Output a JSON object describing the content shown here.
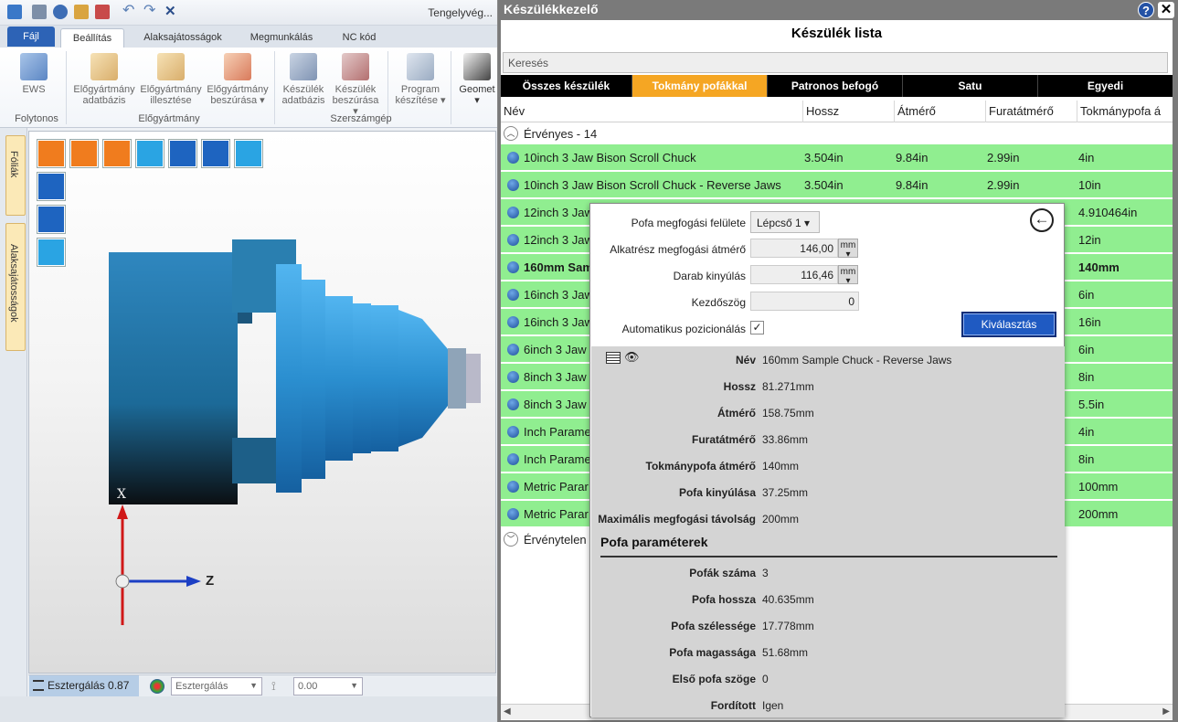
{
  "app": {
    "title": "Tengelyvég...",
    "file_tab": "Fájl",
    "tabs": [
      "Beállítás",
      "Alaksajátosságok",
      "Megmunkálás",
      "NC kód"
    ],
    "ribbon": {
      "ews": "EWS",
      "blank_db": [
        "Előgyártmány",
        "adatbázis"
      ],
      "blank_fit": [
        "Előgyártmány",
        "illesztése"
      ],
      "blank_insert": [
        "Előgyártmány",
        "beszúrása ▾"
      ],
      "dev_db": [
        "Készülék",
        "adatbázis"
      ],
      "dev_insert": [
        "Készülék",
        "beszúrása ▾"
      ],
      "prog_create": [
        "Program",
        "készítése ▾"
      ],
      "geom": [
        "Geomet",
        "▾"
      ],
      "groups": [
        "Folytonos",
        "Előgyártmány",
        "Szerszámgép"
      ]
    },
    "side_tabs": [
      "Fóliák",
      "Alaksajátosságok"
    ],
    "axes": {
      "x": "X",
      "z": "Z"
    },
    "status": {
      "mode_label": "Esztergálás 0.87",
      "op_select": "Esztergálás",
      "value_select": "0.00"
    }
  },
  "dialog": {
    "title": "Készülékkezelő",
    "help": "?",
    "close": "✕",
    "list_title": "Készülék lista",
    "search_placeholder": "Keresés",
    "categories": [
      "Összes készülék",
      "Tokmány pofákkal",
      "Patronos befogó",
      "Satu",
      "Egyedi"
    ],
    "selected_category": "Tokmány pofákkal",
    "columns": [
      "Név",
      "Hossz",
      "Átmérő",
      "Furatátmérő",
      "Tokmánypofa á"
    ],
    "valid_group": "Érvényes - 14",
    "invalid_group": "Érvénytelen",
    "rows": [
      {
        "name": "10inch 3 Jaw Bison Scroll Chuck",
        "len": "3.504in",
        "dia": "9.84in",
        "bore": "2.99in",
        "jaw": "4in"
      },
      {
        "name": "10inch 3 Jaw Bison Scroll Chuck - Reverse Jaws",
        "len": "3.504in",
        "dia": "9.84in",
        "bore": "2.99in",
        "jaw": "10in"
      },
      {
        "name": "12inch 3 Jaw",
        "len": "",
        "dia": "",
        "bore": "",
        "jaw": "4.910464in"
      },
      {
        "name": "12inch 3 Jaw",
        "len": "",
        "dia": "",
        "bore": "",
        "jaw": "12in"
      },
      {
        "name": "160mm Sam",
        "len": "",
        "dia": "",
        "bore": "",
        "jaw": "140mm"
      },
      {
        "name": "16inch 3 Jaw",
        "len": "",
        "dia": "",
        "bore": "",
        "jaw": "6in"
      },
      {
        "name": "16inch 3 Jaw",
        "len": "",
        "dia": "",
        "bore": "",
        "jaw": "16in"
      },
      {
        "name": "6inch 3 Jaw",
        "len": "",
        "dia": "",
        "bore": "",
        "jaw": "6in"
      },
      {
        "name": "8inch 3 Jaw",
        "len": "",
        "dia": "",
        "bore": "",
        "jaw": "8in"
      },
      {
        "name": "8inch 3 Jaw",
        "len": "",
        "dia": "",
        "bore": "",
        "jaw": "5.5in"
      },
      {
        "name": "Inch Parame",
        "len": "",
        "dia": "",
        "bore": "",
        "jaw": "4in"
      },
      {
        "name": "Inch Parame",
        "len": "",
        "dia": "",
        "bore": "",
        "jaw": "8in"
      },
      {
        "name": "Metric Parar",
        "len": "",
        "dia": "",
        "bore": "",
        "jaw": "100mm"
      },
      {
        "name": "Metric Parar",
        "len": "",
        "dia": "",
        "bore": "",
        "jaw": "200mm"
      }
    ]
  },
  "popup": {
    "surface_label": "Pofa megfogási felülete",
    "surface_value": "Lépcső 1 ▾",
    "part_dia_label": "Alkatrész megfogási átmérő",
    "part_dia_value": "146,00",
    "protrusion_label": "Darab kinyúlás",
    "protrusion_value": "116,46",
    "unit": "mm",
    "start_angle_label": "Kezdőszög",
    "start_angle_value": "0",
    "auto_pos_label": "Automatikus pozicionálás",
    "auto_pos_checked": "✓",
    "select_button": "Kiválasztás",
    "details": [
      {
        "label": "Név",
        "value": "160mm Sample Chuck - Reverse Jaws"
      },
      {
        "label": "Hossz",
        "value": "81.271mm"
      },
      {
        "label": "Átmérő",
        "value": "158.75mm"
      },
      {
        "label": "Furatátmérő",
        "value": "33.86mm"
      },
      {
        "label": "Tokmánypofa átmérő",
        "value": "140mm"
      },
      {
        "label": "Pofa kinyúlása",
        "value": "37.25mm"
      },
      {
        "label": "Maximális megfogási távolság",
        "value": "200mm"
      }
    ],
    "jaw_section": "Pofa paraméterek",
    "jaw_details": [
      {
        "label": "Pofák száma",
        "value": "3"
      },
      {
        "label": "Pofa hossza",
        "value": "40.635mm"
      },
      {
        "label": "Pofa szélessége",
        "value": "17.778mm"
      },
      {
        "label": "Pofa magassága",
        "value": "51.68mm"
      },
      {
        "label": "Első pofa szöge",
        "value": "0"
      },
      {
        "label": "Fordított",
        "value": "Igen"
      }
    ]
  },
  "colors": {
    "accent_orange": "#f5a623",
    "valid_green": "#90ee90",
    "ribbon_blue": "#2d63b6",
    "select_btn": "#1f5ac2"
  }
}
